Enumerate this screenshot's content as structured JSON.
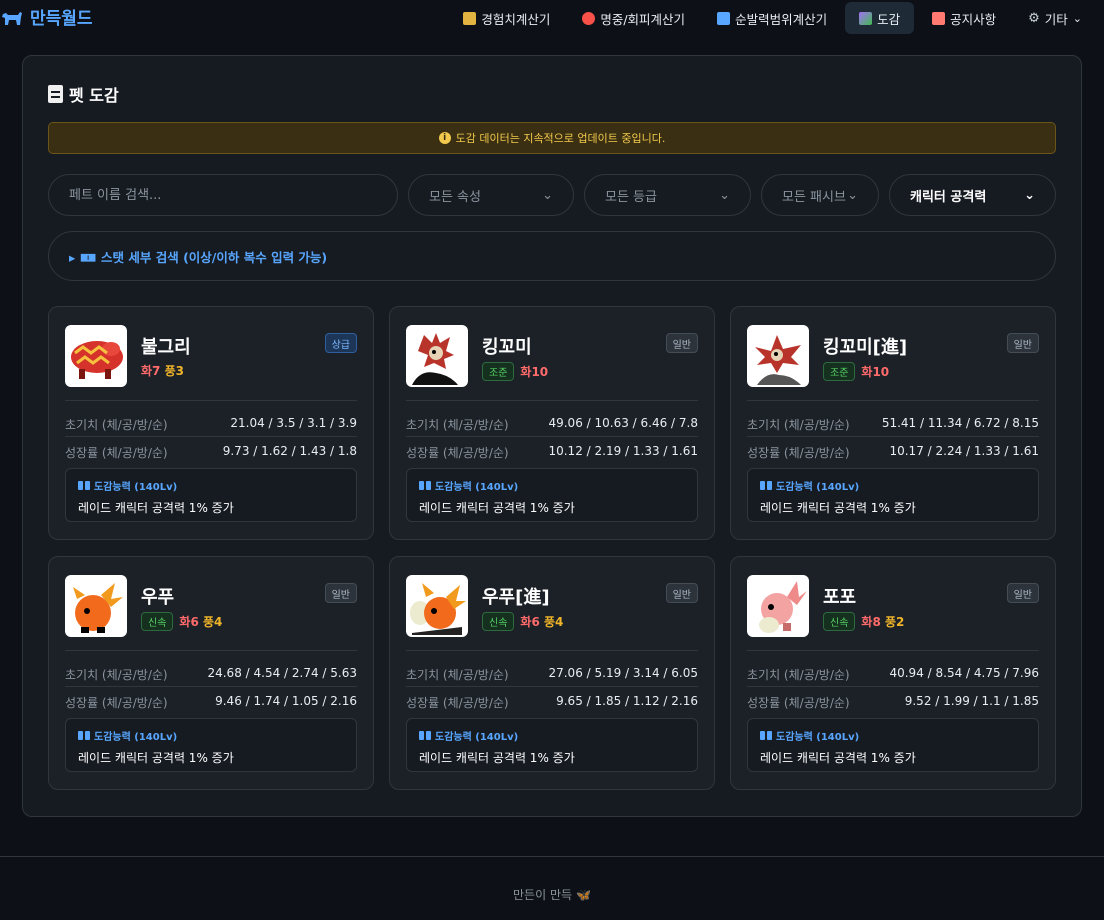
{
  "app": {
    "title": "만득월드"
  },
  "nav": {
    "items": [
      {
        "label": "경험치계산기",
        "icon": "chart-icon",
        "color": "#e3b341"
      },
      {
        "label": "명중/회피계산기",
        "icon": "target-icon",
        "color": "#f85149"
      },
      {
        "label": "순발력범위계산기",
        "icon": "refresh-icon",
        "color": "#58a6ff"
      },
      {
        "label": "도감",
        "icon": "palette-icon",
        "color": "#a371f7",
        "active": true
      },
      {
        "label": "공지사항",
        "icon": "megaphone-icon",
        "color": "#ff7b72"
      },
      {
        "label": "기타",
        "icon": "gear-icon",
        "color": "#c9d1d9"
      }
    ]
  },
  "page": {
    "title": "펫 도감"
  },
  "notice": {
    "text": "도감 데이터는 지속적으로 업데이트 중입니다."
  },
  "filters": {
    "search_placeholder": "페트 이름 검색...",
    "element": "모든 속성",
    "grade": "모든 등급",
    "passive": "모든 패시브",
    "ability": "캐릭터 공격력"
  },
  "advanced_search": {
    "label": "▸ 🀰 스탯 세부 검색 (이상/이하 복수 입력 가능)",
    "text": "스탯 세부 검색 (이상/이하 복수 입력 가능)"
  },
  "labels": {
    "initial": "초기치 (체/공/방/순)",
    "growth": "성장률 (체/공/방/순)",
    "ability_title": "도감능력 (140Lv)"
  },
  "pets": [
    {
      "name": "불그리",
      "grade": "상급",
      "grade_style": "up",
      "type": "",
      "fire": "화7",
      "wind": "풍3",
      "initial": "21.04 / 3.5 / 3.1 / 3.9",
      "growth": "9.73 / 1.62 / 1.43 / 1.8",
      "ability": "레이드 캐릭터 공격력 1% 증가"
    },
    {
      "name": "킹꼬미",
      "grade": "일반",
      "grade_style": "normal",
      "type": "조준",
      "fire": "화10",
      "wind": "",
      "initial": "49.06 / 10.63 / 6.46 / 7.8",
      "growth": "10.12 / 2.19 / 1.33 / 1.61",
      "ability": "레이드 캐릭터 공격력 1% 증가"
    },
    {
      "name": "킹꼬미[進]",
      "grade": "일반",
      "grade_style": "normal",
      "type": "조준",
      "fire": "화10",
      "wind": "",
      "initial": "51.41 / 11.34 / 6.72 / 8.15",
      "growth": "10.17 / 2.24 / 1.33 / 1.61",
      "ability": "레이드 캐릭터 공격력 1% 증가"
    },
    {
      "name": "우푸",
      "grade": "일반",
      "grade_style": "normal",
      "type": "신속",
      "fire": "화6",
      "wind": "풍4",
      "initial": "24.68 / 4.54 / 2.74 / 5.63",
      "growth": "9.46 / 1.74 / 1.05 / 2.16",
      "ability": "레이드 캐릭터 공격력 1% 증가"
    },
    {
      "name": "우푸[進]",
      "grade": "일반",
      "grade_style": "normal",
      "type": "신속",
      "fire": "화6",
      "wind": "풍4",
      "initial": "27.06 / 5.19 / 3.14 / 6.05",
      "growth": "9.65 / 1.85 / 1.12 / 2.16",
      "ability": "레이드 캐릭터 공격력 1% 증가"
    },
    {
      "name": "포포",
      "grade": "일반",
      "grade_style": "normal",
      "type": "신속",
      "fire": "화8",
      "wind": "풍2",
      "initial": "40.94 / 8.54 / 4.75 / 7.96",
      "growth": "9.52 / 1.99 / 1.1 / 1.85",
      "ability": "레이드 캐릭터 공격력 1% 증가"
    }
  ],
  "footer": {
    "text": "만든이 만득"
  }
}
